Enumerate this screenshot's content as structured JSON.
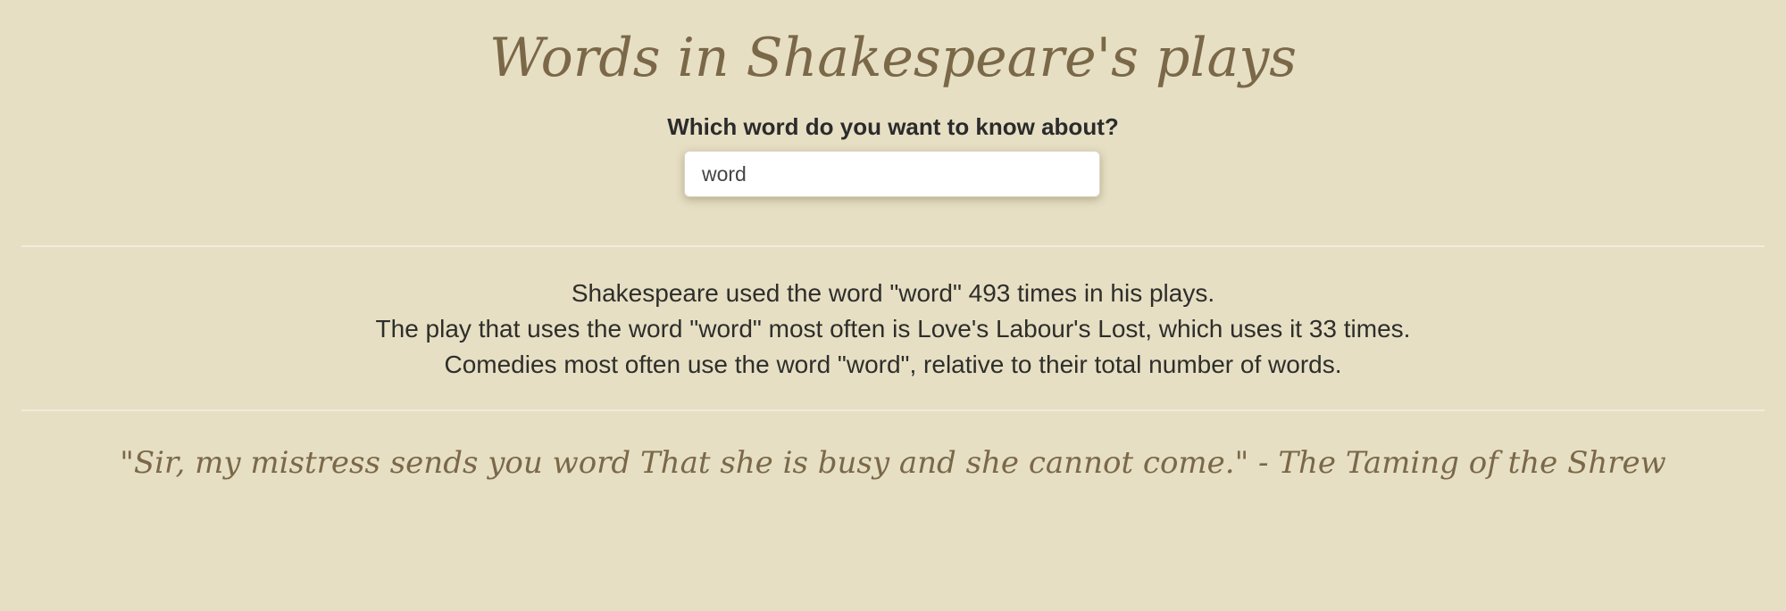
{
  "header": {
    "title": "Words in Shakespeare's plays"
  },
  "search": {
    "label": "Which word do you want to know about?",
    "value": "word"
  },
  "results": {
    "line1": "Shakespeare used the word \"word\" 493 times in his plays.",
    "line2": "The play that uses the word \"word\" most often is Love's Labour's Lost, which uses it 33 times.",
    "line3": "Comedies most often use the word \"word\", relative to their total number of words."
  },
  "quote": {
    "text": "\"Sir, my mistress sends you word That she is busy and she cannot come.\" - The Taming of the Shrew"
  },
  "colors": {
    "background": "#e6dfc4",
    "accent": "#7a6848",
    "text": "#2e2e2a"
  }
}
